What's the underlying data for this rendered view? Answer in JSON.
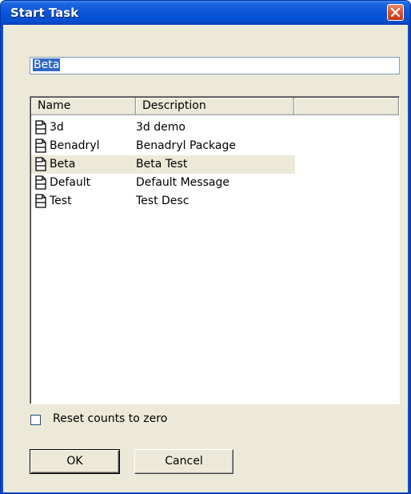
{
  "window": {
    "title": "Start Task",
    "close_icon": "close-icon"
  },
  "filter": {
    "value": "Beta"
  },
  "list": {
    "columns": [
      "Name",
      "Description",
      ""
    ],
    "rows": [
      {
        "name": "3d",
        "description": "3d demo",
        "icon": "document-icon",
        "selected": false
      },
      {
        "name": "Benadryl",
        "description": "Benadryl Package",
        "icon": "document-icon",
        "selected": false
      },
      {
        "name": "Beta",
        "description": "Beta Test",
        "icon": "document-icon",
        "selected": true
      },
      {
        "name": "Default",
        "description": "Default Message",
        "icon": "document-icon",
        "selected": false
      },
      {
        "name": "Test",
        "description": "Test Desc",
        "icon": "document-icon",
        "selected": false
      }
    ]
  },
  "options": {
    "reset_label": "Reset counts to zero",
    "reset_checked": false
  },
  "buttons": {
    "ok_label": "OK",
    "cancel_label": "Cancel"
  },
  "colors": {
    "title_bar": "#0a54d8",
    "face": "#ece9d8",
    "selection_highlight": "#316ac5"
  }
}
